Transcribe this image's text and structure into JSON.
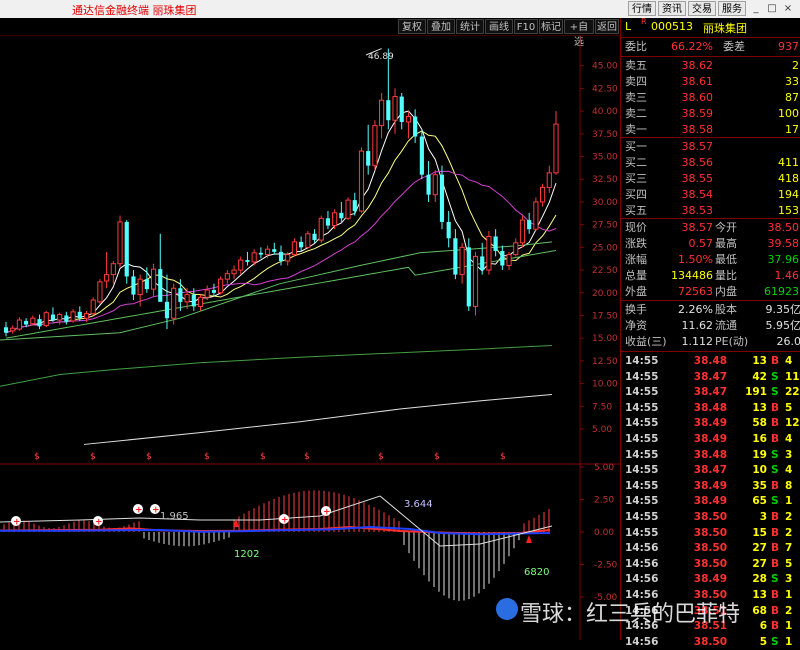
{
  "window": {
    "title": "通达信金融终端  丽珠集团",
    "buttons": [
      "行情",
      "资讯",
      "交易",
      "服务"
    ],
    "controls": [
      "_",
      "□",
      "×"
    ]
  },
  "toolbar": {
    "buttons": [
      "复权",
      "叠加",
      "统计",
      "画线",
      "F10",
      "标记",
      "+自选",
      "返回"
    ]
  },
  "stock": {
    "prefix": "L",
    "tag": "R",
    "code": "000513",
    "name": "丽珠集团"
  },
  "chart_data": {
    "type": "candlestick",
    "y_ticks": [
      "45.00",
      "42.50",
      "40.00",
      "37.50",
      "35.00",
      "32.50",
      "30.00",
      "27.50",
      "25.00",
      "22.50",
      "20.00",
      "17.50",
      "15.00",
      "12.50",
      "10.00",
      "7.50",
      "5.00"
    ],
    "ylim": [
      5.0,
      46.89
    ],
    "max_label": "46.89",
    "dividend_marker": "$",
    "candles": [
      {
        "o": 16.2,
        "h": 16.8,
        "l": 15.2,
        "c": 15.6
      },
      {
        "o": 15.8,
        "h": 16.4,
        "l": 15.5,
        "c": 16.1
      },
      {
        "o": 16.0,
        "h": 17.3,
        "l": 15.8,
        "c": 17.0
      },
      {
        "o": 16.9,
        "h": 17.2,
        "l": 16.2,
        "c": 16.5
      },
      {
        "o": 16.6,
        "h": 17.5,
        "l": 16.4,
        "c": 17.2
      },
      {
        "o": 17.1,
        "h": 17.6,
        "l": 16.0,
        "c": 16.3
      },
      {
        "o": 16.4,
        "h": 18.0,
        "l": 16.2,
        "c": 17.8
      },
      {
        "o": 17.6,
        "h": 18.4,
        "l": 16.8,
        "c": 17.0
      },
      {
        "o": 17.0,
        "h": 17.8,
        "l": 16.5,
        "c": 17.6
      },
      {
        "o": 17.5,
        "h": 17.9,
        "l": 16.5,
        "c": 16.8
      },
      {
        "o": 16.9,
        "h": 18.2,
        "l": 16.7,
        "c": 17.9
      },
      {
        "o": 17.9,
        "h": 18.5,
        "l": 16.9,
        "c": 17.2
      },
      {
        "o": 17.2,
        "h": 18.0,
        "l": 16.8,
        "c": 17.7
      },
      {
        "o": 17.7,
        "h": 19.5,
        "l": 17.5,
        "c": 19.2
      },
      {
        "o": 19.0,
        "h": 21.5,
        "l": 18.8,
        "c": 21.2
      },
      {
        "o": 21.3,
        "h": 24.5,
        "l": 20.5,
        "c": 22.0
      },
      {
        "o": 22.0,
        "h": 23.5,
        "l": 21.0,
        "c": 23.2
      },
      {
        "o": 23.2,
        "h": 28.5,
        "l": 22.8,
        "c": 27.8
      },
      {
        "o": 27.8,
        "h": 28.0,
        "l": 21.0,
        "c": 21.8
      },
      {
        "o": 21.8,
        "h": 22.5,
        "l": 19.2,
        "c": 19.8
      },
      {
        "o": 19.8,
        "h": 22.0,
        "l": 18.5,
        "c": 21.5
      },
      {
        "o": 21.5,
        "h": 22.8,
        "l": 20.0,
        "c": 20.4
      },
      {
        "o": 20.4,
        "h": 23.2,
        "l": 19.5,
        "c": 22.6
      },
      {
        "o": 22.6,
        "h": 26.5,
        "l": 22.0,
        "c": 19.0
      },
      {
        "o": 19.0,
        "h": 22.0,
        "l": 16.0,
        "c": 17.2
      },
      {
        "o": 17.2,
        "h": 21.0,
        "l": 16.5,
        "c": 20.5
      },
      {
        "o": 20.5,
        "h": 21.5,
        "l": 18.0,
        "c": 19.0
      },
      {
        "o": 19.0,
        "h": 20.5,
        "l": 18.2,
        "c": 19.8
      },
      {
        "o": 19.8,
        "h": 20.5,
        "l": 18.0,
        "c": 18.5
      },
      {
        "o": 18.5,
        "h": 19.8,
        "l": 18.0,
        "c": 19.5
      },
      {
        "o": 19.5,
        "h": 20.8,
        "l": 19.2,
        "c": 20.3
      },
      {
        "o": 20.3,
        "h": 21.0,
        "l": 19.6,
        "c": 20.0
      },
      {
        "o": 20.0,
        "h": 21.8,
        "l": 19.8,
        "c": 21.5
      },
      {
        "o": 21.5,
        "h": 22.5,
        "l": 21.0,
        "c": 22.1
      },
      {
        "o": 22.1,
        "h": 23.0,
        "l": 21.5,
        "c": 22.5
      },
      {
        "o": 22.5,
        "h": 24.0,
        "l": 22.0,
        "c": 23.6
      },
      {
        "o": 23.6,
        "h": 24.5,
        "l": 23.0,
        "c": 23.4
      },
      {
        "o": 23.4,
        "h": 24.8,
        "l": 23.0,
        "c": 24.4
      },
      {
        "o": 24.4,
        "h": 25.0,
        "l": 23.8,
        "c": 24.2
      },
      {
        "o": 24.2,
        "h": 25.2,
        "l": 23.8,
        "c": 24.8
      },
      {
        "o": 24.8,
        "h": 25.5,
        "l": 24.2,
        "c": 24.5
      },
      {
        "o": 24.5,
        "h": 25.2,
        "l": 23.0,
        "c": 23.5
      },
      {
        "o": 23.5,
        "h": 24.5,
        "l": 23.0,
        "c": 24.2
      },
      {
        "o": 24.2,
        "h": 26.0,
        "l": 24.0,
        "c": 25.6
      },
      {
        "o": 25.6,
        "h": 26.2,
        "l": 24.5,
        "c": 25.0
      },
      {
        "o": 25.0,
        "h": 26.8,
        "l": 24.8,
        "c": 26.5
      },
      {
        "o": 26.5,
        "h": 27.0,
        "l": 25.5,
        "c": 25.8
      },
      {
        "o": 25.8,
        "h": 28.5,
        "l": 25.5,
        "c": 28.2
      },
      {
        "o": 28.2,
        "h": 29.0,
        "l": 27.0,
        "c": 27.4
      },
      {
        "o": 27.4,
        "h": 29.2,
        "l": 27.0,
        "c": 28.8
      },
      {
        "o": 28.8,
        "h": 30.0,
        "l": 27.8,
        "c": 28.2
      },
      {
        "o": 28.2,
        "h": 30.5,
        "l": 28.0,
        "c": 30.2
      },
      {
        "o": 30.2,
        "h": 31.0,
        "l": 28.5,
        "c": 29.0
      },
      {
        "o": 29.0,
        "h": 36.0,
        "l": 28.8,
        "c": 35.6
      },
      {
        "o": 35.6,
        "h": 38.5,
        "l": 33.0,
        "c": 34.0
      },
      {
        "o": 34.0,
        "h": 39.0,
        "l": 33.5,
        "c": 38.4
      },
      {
        "o": 38.4,
        "h": 42.0,
        "l": 37.0,
        "c": 41.2
      },
      {
        "o": 41.2,
        "h": 46.89,
        "l": 38.0,
        "c": 39.0
      },
      {
        "o": 39.0,
        "h": 42.5,
        "l": 37.5,
        "c": 41.6
      },
      {
        "o": 41.6,
        "h": 42.0,
        "l": 38.0,
        "c": 38.8
      },
      {
        "o": 38.8,
        "h": 40.0,
        "l": 37.0,
        "c": 39.4
      },
      {
        "o": 39.4,
        "h": 40.2,
        "l": 36.5,
        "c": 37.2
      },
      {
        "o": 37.2,
        "h": 38.0,
        "l": 32.5,
        "c": 33.0
      },
      {
        "o": 33.0,
        "h": 34.5,
        "l": 30.0,
        "c": 30.8
      },
      {
        "o": 30.8,
        "h": 33.5,
        "l": 30.0,
        "c": 33.0
      },
      {
        "o": 33.0,
        "h": 34.0,
        "l": 27.0,
        "c": 27.8
      },
      {
        "o": 27.8,
        "h": 29.0,
        "l": 25.0,
        "c": 26.0
      },
      {
        "o": 26.0,
        "h": 27.0,
        "l": 21.5,
        "c": 22.0
      },
      {
        "o": 22.0,
        "h": 25.5,
        "l": 21.0,
        "c": 25.0
      },
      {
        "o": 25.0,
        "h": 26.0,
        "l": 18.0,
        "c": 18.5
      },
      {
        "o": 18.5,
        "h": 24.5,
        "l": 17.5,
        "c": 24.0
      },
      {
        "o": 24.0,
        "h": 25.5,
        "l": 22.0,
        "c": 22.5
      },
      {
        "o": 22.5,
        "h": 26.8,
        "l": 22.0,
        "c": 26.2
      },
      {
        "o": 26.2,
        "h": 27.0,
        "l": 24.0,
        "c": 24.6
      },
      {
        "o": 24.6,
        "h": 25.2,
        "l": 22.5,
        "c": 23.0
      },
      {
        "o": 23.0,
        "h": 24.5,
        "l": 22.5,
        "c": 24.2
      },
      {
        "o": 24.2,
        "h": 26.0,
        "l": 24.0,
        "c": 25.5
      },
      {
        "o": 25.5,
        "h": 28.5,
        "l": 25.0,
        "c": 28.0
      },
      {
        "o": 28.0,
        "h": 28.8,
        "l": 26.5,
        "c": 27.0
      },
      {
        "o": 27.0,
        "h": 30.5,
        "l": 26.8,
        "c": 30.0
      },
      {
        "o": 30.0,
        "h": 32.0,
        "l": 29.5,
        "c": 31.6
      },
      {
        "o": 31.6,
        "h": 34.0,
        "l": 31.0,
        "c": 33.2
      },
      {
        "o": 33.2,
        "h": 40.0,
        "l": 33.0,
        "c": 38.57
      }
    ]
  },
  "macd": {
    "ticks": [
      "5.00",
      "2.50",
      "0.00",
      "-2.50",
      "-5.00"
    ],
    "labels": [
      "1.965",
      "1202",
      "3.644",
      "6820"
    ]
  },
  "quote": {
    "weibi": {
      "label": "委比",
      "value": "66.22%",
      "label2": "委差",
      "value2": "937"
    },
    "asks": [
      {
        "label": "卖五",
        "price": "38.62",
        "vol": "2"
      },
      {
        "label": "卖四",
        "price": "38.61",
        "vol": "33"
      },
      {
        "label": "卖三",
        "price": "38.60",
        "vol": "87"
      },
      {
        "label": "卖二",
        "price": "38.59",
        "vol": "100"
      },
      {
        "label": "卖一",
        "price": "38.58",
        "vol": "17"
      }
    ],
    "bids": [
      {
        "label": "买一",
        "price": "38.57",
        "vol": ""
      },
      {
        "label": "买二",
        "price": "38.56",
        "vol": "411"
      },
      {
        "label": "买三",
        "price": "38.55",
        "vol": "418"
      },
      {
        "label": "买四",
        "price": "38.54",
        "vol": "194"
      },
      {
        "label": "买五",
        "price": "38.53",
        "vol": "153"
      }
    ],
    "stats": [
      {
        "l1": "现价",
        "v1": "38.57",
        "c1": "red",
        "l2": "今开",
        "v2": "38.50",
        "c2": "red"
      },
      {
        "l1": "涨跌",
        "v1": "0.57",
        "c1": "red",
        "l2": "最高",
        "v2": "39.58",
        "c2": "red"
      },
      {
        "l1": "涨幅",
        "v1": "1.50%",
        "c1": "red",
        "l2": "最低",
        "v2": "37.96",
        "c2": "grn"
      },
      {
        "l1": "总量",
        "v1": "134486",
        "c1": "yel",
        "l2": "量比",
        "v2": "1.46",
        "c2": "red"
      },
      {
        "l1": "外盘",
        "v1": "72563",
        "c1": "red",
        "l2": "内盘",
        "v2": "61923",
        "c2": "grn"
      }
    ],
    "stats2": [
      {
        "l1": "换手",
        "v1": "2.26%",
        "l2": "股本",
        "v2": "9.35亿"
      },
      {
        "l1": "净资",
        "v1": "11.62",
        "l2": "流通",
        "v2": "5.95亿"
      },
      {
        "l1": "收益(三)",
        "v1": "1.112",
        "l2": "PE(动)",
        "v2": "26.0"
      }
    ]
  },
  "ticks": [
    {
      "time": "14:55",
      "price": "38.48",
      "vol": "13",
      "bs": "B",
      "n": "4"
    },
    {
      "time": "14:55",
      "price": "38.47",
      "vol": "42",
      "bs": "S",
      "n": "11"
    },
    {
      "time": "14:55",
      "price": "38.47",
      "vol": "191",
      "bs": "S",
      "n": "22"
    },
    {
      "time": "14:55",
      "price": "38.48",
      "vol": "13",
      "bs": "B",
      "n": "5"
    },
    {
      "time": "14:55",
      "price": "38.49",
      "vol": "58",
      "bs": "B",
      "n": "12"
    },
    {
      "time": "14:55",
      "price": "38.49",
      "vol": "16",
      "bs": "B",
      "n": "4"
    },
    {
      "time": "14:55",
      "price": "38.48",
      "vol": "19",
      "bs": "S",
      "n": "3"
    },
    {
      "time": "14:55",
      "price": "38.47",
      "vol": "10",
      "bs": "S",
      "n": "4"
    },
    {
      "time": "14:55",
      "price": "38.49",
      "vol": "35",
      "bs": "B",
      "n": "8"
    },
    {
      "time": "14:55",
      "price": "38.49",
      "vol": "65",
      "bs": "S",
      "n": "1"
    },
    {
      "time": "14:55",
      "price": "38.50",
      "vol": "3",
      "bs": "B",
      "n": "2"
    },
    {
      "time": "14:55",
      "price": "38.50",
      "vol": "15",
      "bs": "B",
      "n": "2"
    },
    {
      "time": "14:56",
      "price": "38.50",
      "vol": "27",
      "bs": "B",
      "n": "7"
    },
    {
      "time": "14:56",
      "price": "38.50",
      "vol": "27",
      "bs": "B",
      "n": "5"
    },
    {
      "time": "14:56",
      "price": "38.49",
      "vol": "28",
      "bs": "S",
      "n": "3"
    },
    {
      "time": "14:56",
      "price": "38.50",
      "vol": "13",
      "bs": "B",
      "n": "1"
    },
    {
      "time": "14:56",
      "price": "38.51",
      "vol": "68",
      "bs": "B",
      "n": "2"
    },
    {
      "time": "14:56",
      "price": "38.51",
      "vol": "6",
      "bs": "B",
      "n": "1"
    },
    {
      "time": "14:56",
      "price": "38.50",
      "vol": "5",
      "bs": "S",
      "n": "1"
    }
  ],
  "watermark": "雪球：红三兵的巴菲特"
}
